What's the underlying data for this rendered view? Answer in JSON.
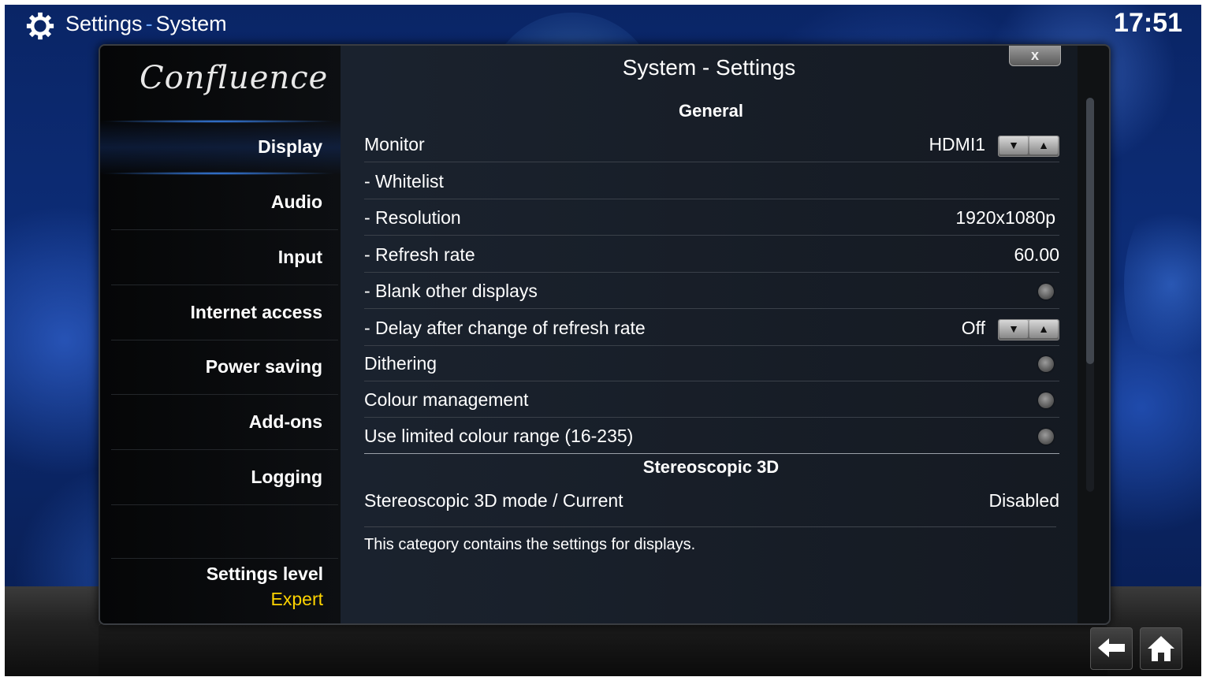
{
  "header": {
    "section": "Settings",
    "page": "System",
    "time": "17:51"
  },
  "dialog": {
    "title": "System - Settings",
    "close_label": "x"
  },
  "sidebar": {
    "logo": "Confluence",
    "items": [
      {
        "label": "Display",
        "selected": true
      },
      {
        "label": "Audio"
      },
      {
        "label": "Input"
      },
      {
        "label": "Internet access"
      },
      {
        "label": "Power saving"
      },
      {
        "label": "Add-ons"
      },
      {
        "label": "Logging"
      }
    ],
    "settings_level": {
      "label": "Settings level",
      "value": "Expert"
    }
  },
  "settings": {
    "general_header": "General",
    "rows": [
      {
        "label": "Monitor",
        "value": "HDMI1",
        "control": "spinner"
      },
      {
        "label": "- Whitelist"
      },
      {
        "label": "- Resolution",
        "value": "1920x1080p"
      },
      {
        "label": "- Refresh rate",
        "value": "60.00"
      },
      {
        "label": "- Blank other displays",
        "control": "radio"
      },
      {
        "label": "- Delay after change of refresh rate",
        "value": "Off",
        "control": "spinner"
      },
      {
        "label": "Dithering",
        "control": "radio"
      },
      {
        "label": "Colour management",
        "control": "radio"
      },
      {
        "label": "Use limited colour range (16-235)",
        "control": "radio"
      }
    ],
    "stereo_header": "Stereoscopic 3D",
    "stereo_row": {
      "label": "Stereoscopic 3D mode / Current",
      "value": "Disabled"
    }
  },
  "description": "This category contains the settings for displays.",
  "colors": {
    "accent": "#3d8cff",
    "level_value": "#ffd400"
  },
  "icons": {
    "header": "gear-icon",
    "back": "back-arrow-icon",
    "home": "home-icon"
  }
}
